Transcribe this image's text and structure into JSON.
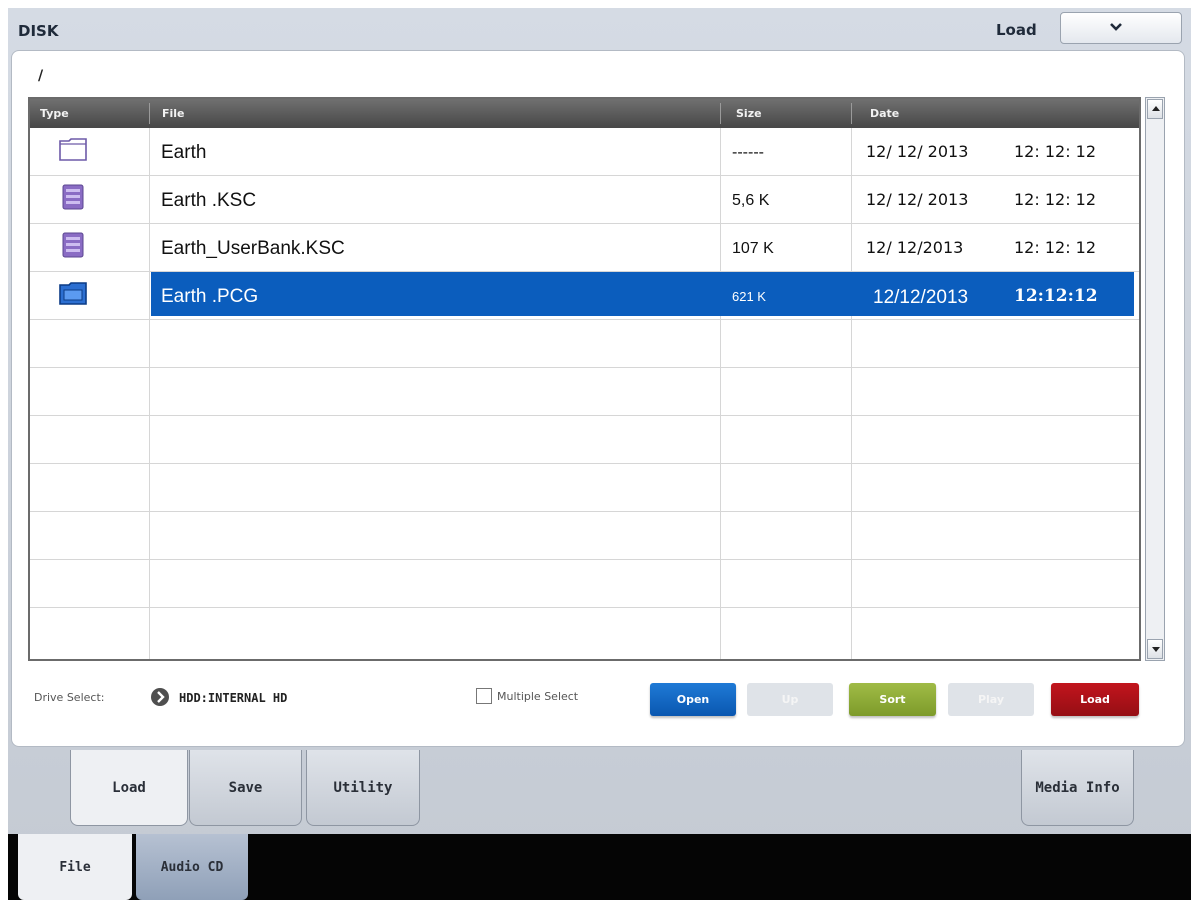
{
  "header": {
    "title": "DISK",
    "mode_label": "Load",
    "dropdown_icon": "chevron-down-icon"
  },
  "path": "/",
  "table": {
    "columns": [
      "Type",
      "File",
      "Size",
      "Date"
    ],
    "rows": [
      {
        "type_icon": "folder-icon",
        "file": "Earth",
        "size": "------",
        "date": "12/ 12/ 2013",
        "time": "12: 12: 12",
        "selected": false
      },
      {
        "type_icon": "ksc-file-icon",
        "file": "Earth .KSC",
        "size": "5,6 K",
        "date": "12/ 12/ 2013",
        "time": "12: 12: 12",
        "selected": false
      },
      {
        "type_icon": "ksc-file-icon",
        "file": "Earth_UserBank.KSC",
        "size": "107 K",
        "date": "12/ 12/2013",
        "time": "12: 12: 12",
        "selected": false
      },
      {
        "type_icon": "pcg-folder-icon",
        "file": "Earth .PCG",
        "size": "621 K",
        "date": "12/12/2013",
        "time": "12:12:12",
        "selected": true
      }
    ]
  },
  "drive": {
    "label": "Drive Select:",
    "value": "HDD:INTERNAL HD"
  },
  "multiple_select": {
    "label": "Multiple Select",
    "checked": false
  },
  "buttons": {
    "open": "Open",
    "up": "Up",
    "sort": "Sort",
    "play": "Play",
    "load": "Load"
  },
  "tabs": {
    "load": "Load",
    "save": "Save",
    "utility": "Utility",
    "media_info": "Media Info"
  },
  "bottom_tabs": {
    "file": "File",
    "audio_cd": "Audio CD"
  },
  "colors": {
    "selection": "#0b5dbd",
    "open_button": "#0a57b0",
    "sort_button": "#7d9b2a",
    "load_button": "#950e14"
  }
}
